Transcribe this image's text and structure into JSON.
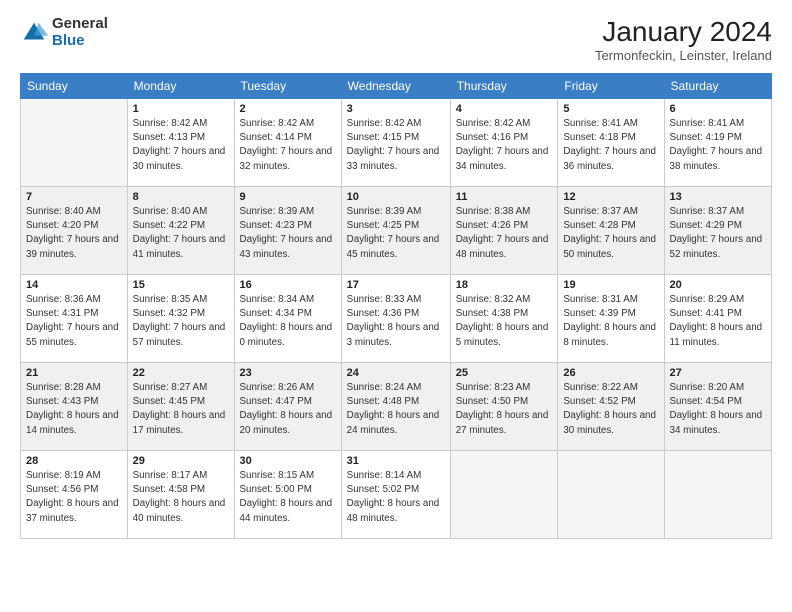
{
  "logo": {
    "general": "General",
    "blue": "Blue"
  },
  "title": "January 2024",
  "location": "Termonfeckin, Leinster, Ireland",
  "days_of_week": [
    "Sunday",
    "Monday",
    "Tuesday",
    "Wednesday",
    "Thursday",
    "Friday",
    "Saturday"
  ],
  "weeks": [
    [
      {
        "num": "",
        "sunrise": "",
        "sunset": "",
        "daylight": ""
      },
      {
        "num": "1",
        "sunrise": "Sunrise: 8:42 AM",
        "sunset": "Sunset: 4:13 PM",
        "daylight": "Daylight: 7 hours and 30 minutes."
      },
      {
        "num": "2",
        "sunrise": "Sunrise: 8:42 AM",
        "sunset": "Sunset: 4:14 PM",
        "daylight": "Daylight: 7 hours and 32 minutes."
      },
      {
        "num": "3",
        "sunrise": "Sunrise: 8:42 AM",
        "sunset": "Sunset: 4:15 PM",
        "daylight": "Daylight: 7 hours and 33 minutes."
      },
      {
        "num": "4",
        "sunrise": "Sunrise: 8:42 AM",
        "sunset": "Sunset: 4:16 PM",
        "daylight": "Daylight: 7 hours and 34 minutes."
      },
      {
        "num": "5",
        "sunrise": "Sunrise: 8:41 AM",
        "sunset": "Sunset: 4:18 PM",
        "daylight": "Daylight: 7 hours and 36 minutes."
      },
      {
        "num": "6",
        "sunrise": "Sunrise: 8:41 AM",
        "sunset": "Sunset: 4:19 PM",
        "daylight": "Daylight: 7 hours and 38 minutes."
      }
    ],
    [
      {
        "num": "7",
        "sunrise": "Sunrise: 8:40 AM",
        "sunset": "Sunset: 4:20 PM",
        "daylight": "Daylight: 7 hours and 39 minutes."
      },
      {
        "num": "8",
        "sunrise": "Sunrise: 8:40 AM",
        "sunset": "Sunset: 4:22 PM",
        "daylight": "Daylight: 7 hours and 41 minutes."
      },
      {
        "num": "9",
        "sunrise": "Sunrise: 8:39 AM",
        "sunset": "Sunset: 4:23 PM",
        "daylight": "Daylight: 7 hours and 43 minutes."
      },
      {
        "num": "10",
        "sunrise": "Sunrise: 8:39 AM",
        "sunset": "Sunset: 4:25 PM",
        "daylight": "Daylight: 7 hours and 45 minutes."
      },
      {
        "num": "11",
        "sunrise": "Sunrise: 8:38 AM",
        "sunset": "Sunset: 4:26 PM",
        "daylight": "Daylight: 7 hours and 48 minutes."
      },
      {
        "num": "12",
        "sunrise": "Sunrise: 8:37 AM",
        "sunset": "Sunset: 4:28 PM",
        "daylight": "Daylight: 7 hours and 50 minutes."
      },
      {
        "num": "13",
        "sunrise": "Sunrise: 8:37 AM",
        "sunset": "Sunset: 4:29 PM",
        "daylight": "Daylight: 7 hours and 52 minutes."
      }
    ],
    [
      {
        "num": "14",
        "sunrise": "Sunrise: 8:36 AM",
        "sunset": "Sunset: 4:31 PM",
        "daylight": "Daylight: 7 hours and 55 minutes."
      },
      {
        "num": "15",
        "sunrise": "Sunrise: 8:35 AM",
        "sunset": "Sunset: 4:32 PM",
        "daylight": "Daylight: 7 hours and 57 minutes."
      },
      {
        "num": "16",
        "sunrise": "Sunrise: 8:34 AM",
        "sunset": "Sunset: 4:34 PM",
        "daylight": "Daylight: 8 hours and 0 minutes."
      },
      {
        "num": "17",
        "sunrise": "Sunrise: 8:33 AM",
        "sunset": "Sunset: 4:36 PM",
        "daylight": "Daylight: 8 hours and 3 minutes."
      },
      {
        "num": "18",
        "sunrise": "Sunrise: 8:32 AM",
        "sunset": "Sunset: 4:38 PM",
        "daylight": "Daylight: 8 hours and 5 minutes."
      },
      {
        "num": "19",
        "sunrise": "Sunrise: 8:31 AM",
        "sunset": "Sunset: 4:39 PM",
        "daylight": "Daylight: 8 hours and 8 minutes."
      },
      {
        "num": "20",
        "sunrise": "Sunrise: 8:29 AM",
        "sunset": "Sunset: 4:41 PM",
        "daylight": "Daylight: 8 hours and 11 minutes."
      }
    ],
    [
      {
        "num": "21",
        "sunrise": "Sunrise: 8:28 AM",
        "sunset": "Sunset: 4:43 PM",
        "daylight": "Daylight: 8 hours and 14 minutes."
      },
      {
        "num": "22",
        "sunrise": "Sunrise: 8:27 AM",
        "sunset": "Sunset: 4:45 PM",
        "daylight": "Daylight: 8 hours and 17 minutes."
      },
      {
        "num": "23",
        "sunrise": "Sunrise: 8:26 AM",
        "sunset": "Sunset: 4:47 PM",
        "daylight": "Daylight: 8 hours and 20 minutes."
      },
      {
        "num": "24",
        "sunrise": "Sunrise: 8:24 AM",
        "sunset": "Sunset: 4:48 PM",
        "daylight": "Daylight: 8 hours and 24 minutes."
      },
      {
        "num": "25",
        "sunrise": "Sunrise: 8:23 AM",
        "sunset": "Sunset: 4:50 PM",
        "daylight": "Daylight: 8 hours and 27 minutes."
      },
      {
        "num": "26",
        "sunrise": "Sunrise: 8:22 AM",
        "sunset": "Sunset: 4:52 PM",
        "daylight": "Daylight: 8 hours and 30 minutes."
      },
      {
        "num": "27",
        "sunrise": "Sunrise: 8:20 AM",
        "sunset": "Sunset: 4:54 PM",
        "daylight": "Daylight: 8 hours and 34 minutes."
      }
    ],
    [
      {
        "num": "28",
        "sunrise": "Sunrise: 8:19 AM",
        "sunset": "Sunset: 4:56 PM",
        "daylight": "Daylight: 8 hours and 37 minutes."
      },
      {
        "num": "29",
        "sunrise": "Sunrise: 8:17 AM",
        "sunset": "Sunset: 4:58 PM",
        "daylight": "Daylight: 8 hours and 40 minutes."
      },
      {
        "num": "30",
        "sunrise": "Sunrise: 8:15 AM",
        "sunset": "Sunset: 5:00 PM",
        "daylight": "Daylight: 8 hours and 44 minutes."
      },
      {
        "num": "31",
        "sunrise": "Sunrise: 8:14 AM",
        "sunset": "Sunset: 5:02 PM",
        "daylight": "Daylight: 8 hours and 48 minutes."
      },
      {
        "num": "",
        "sunrise": "",
        "sunset": "",
        "daylight": ""
      },
      {
        "num": "",
        "sunrise": "",
        "sunset": "",
        "daylight": ""
      },
      {
        "num": "",
        "sunrise": "",
        "sunset": "",
        "daylight": ""
      }
    ]
  ]
}
